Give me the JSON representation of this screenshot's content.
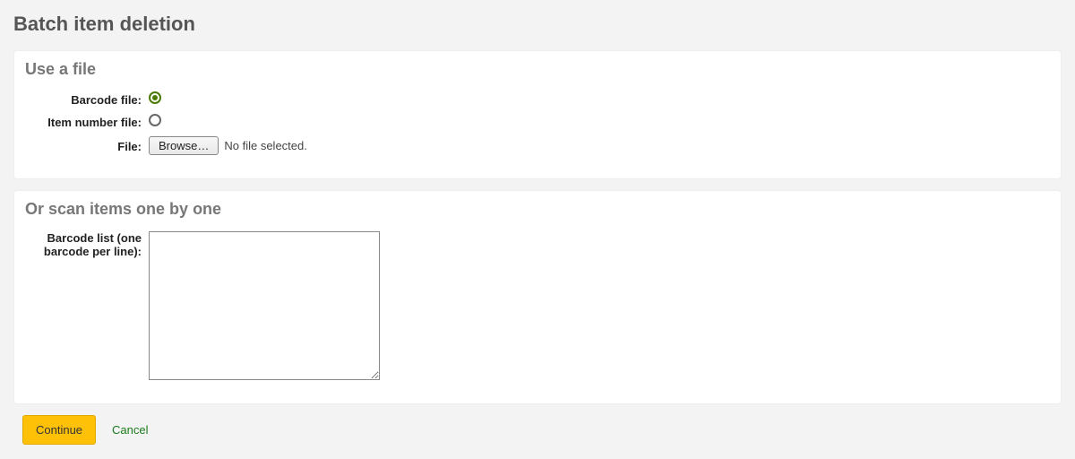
{
  "page": {
    "title": "Batch item deletion"
  },
  "useFile": {
    "heading": "Use a file",
    "barcodeFileLabel": "Barcode file:",
    "itemNumberFileLabel": "Item number file:",
    "fileLabel": "File:",
    "browseLabel": "Browse…",
    "fileStatus": "No file selected.",
    "selected": "barcode"
  },
  "scan": {
    "heading": "Or scan items one by one",
    "barcodeListLabel": "Barcode list (one barcode per line):",
    "barcodeListValue": ""
  },
  "actions": {
    "continueLabel": "Continue",
    "cancelLabel": "Cancel"
  }
}
